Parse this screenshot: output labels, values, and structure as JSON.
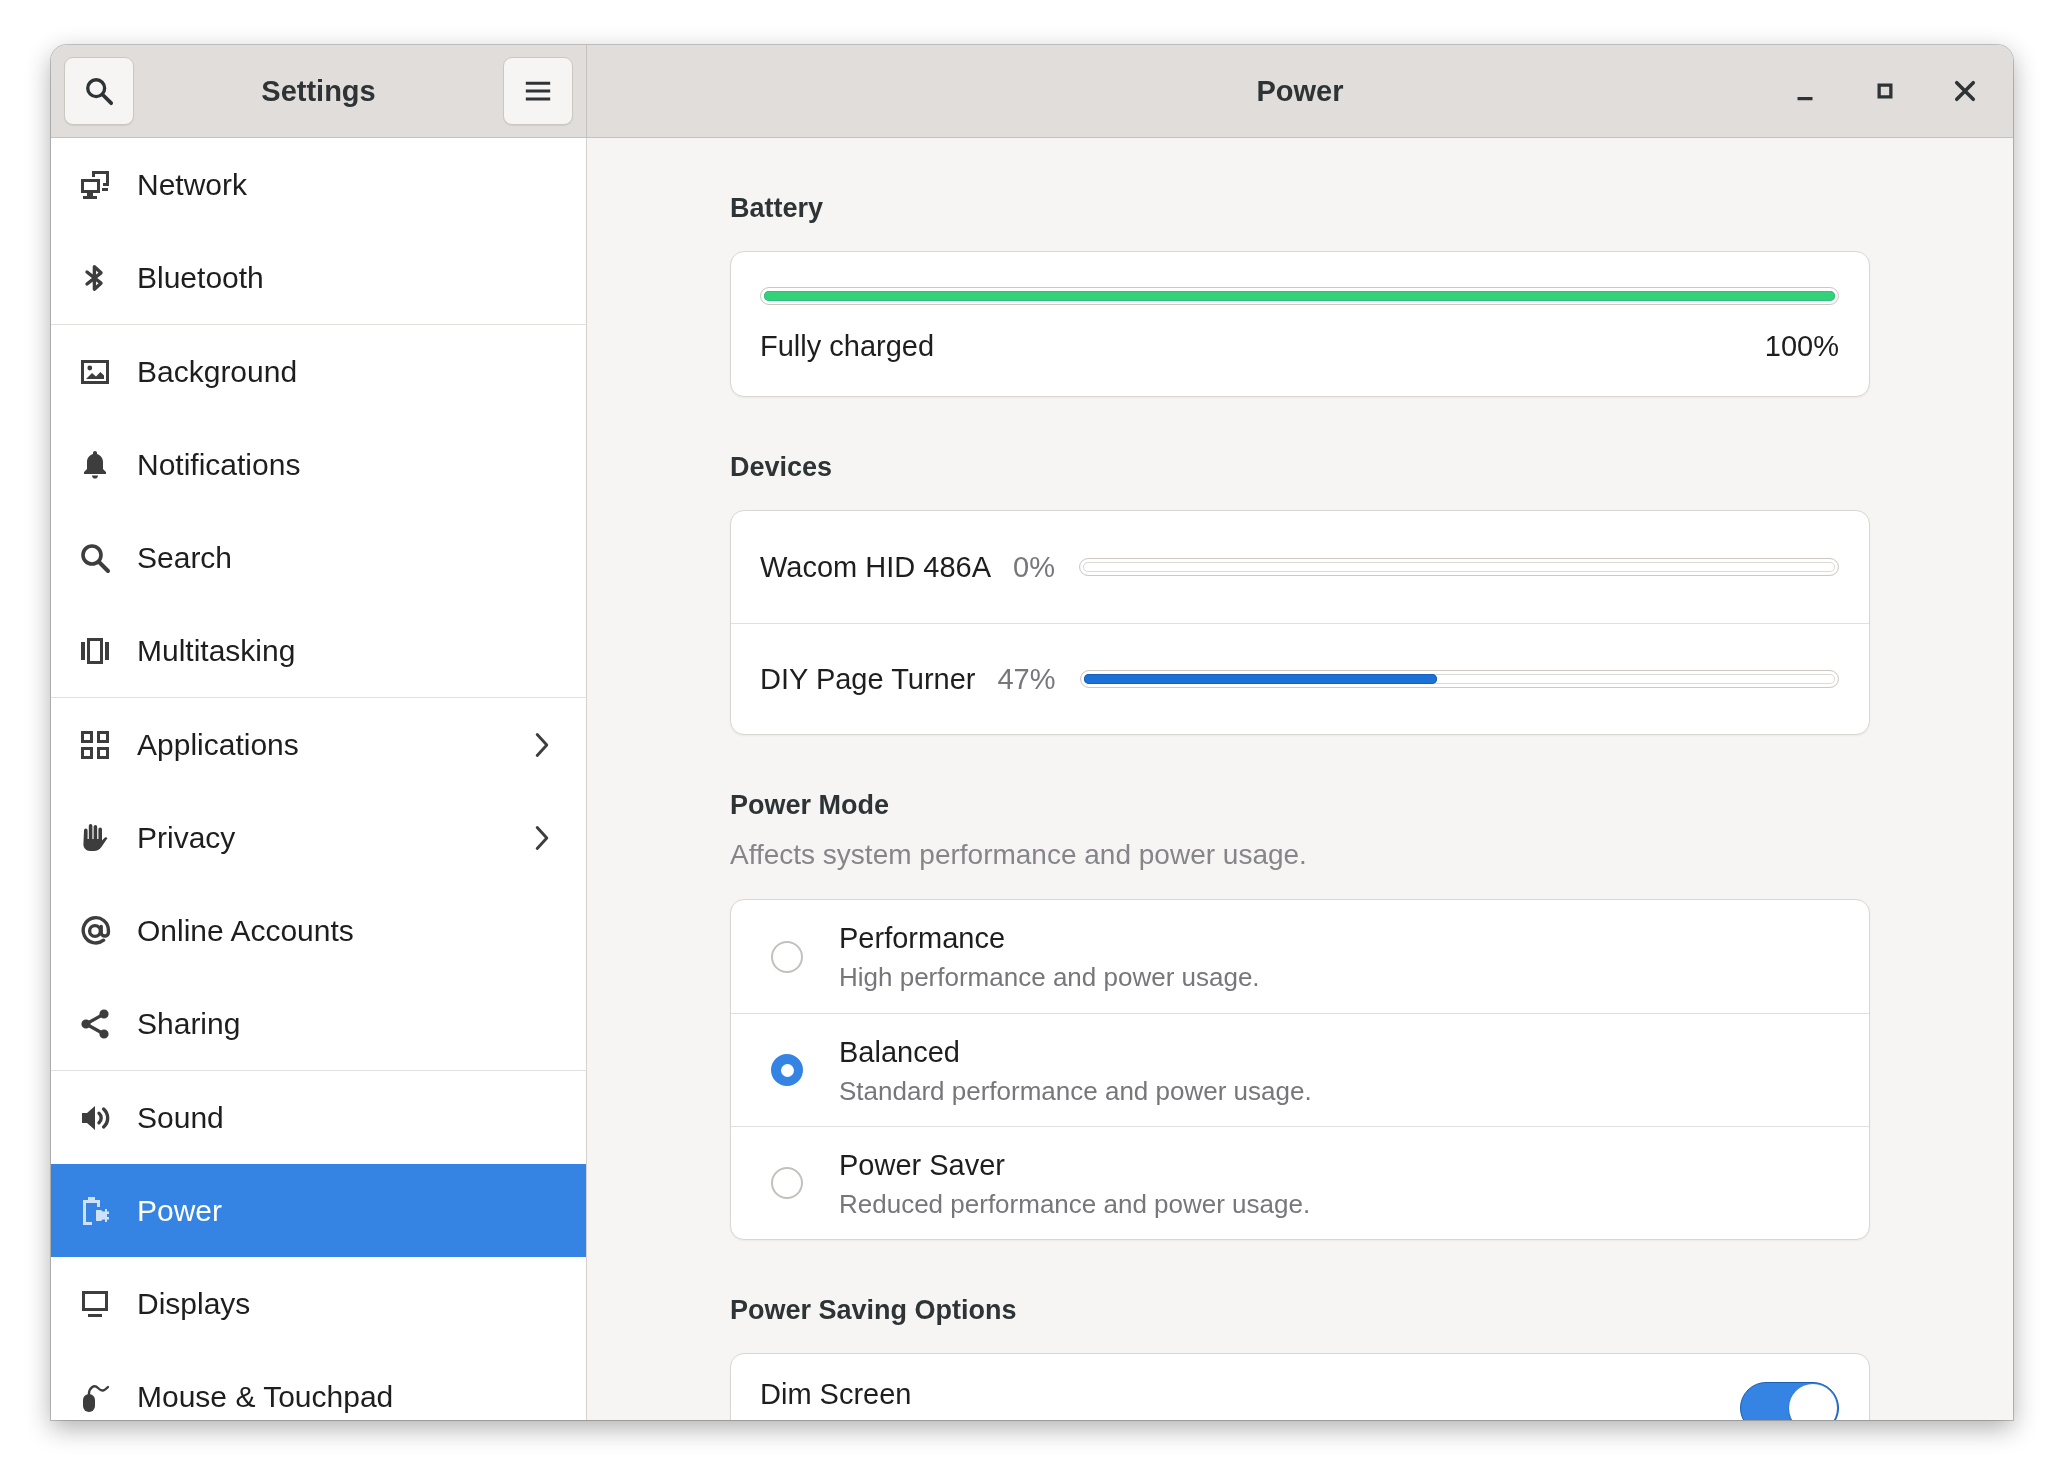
{
  "sidebar": {
    "title": "Settings",
    "groups": [
      {
        "items": [
          {
            "label": "Network",
            "selected": false,
            "has_submenu": false
          },
          {
            "label": "Bluetooth",
            "selected": false,
            "has_submenu": false
          }
        ]
      },
      {
        "items": [
          {
            "label": "Background",
            "selected": false,
            "has_submenu": false
          },
          {
            "label": "Notifications",
            "selected": false,
            "has_submenu": false
          },
          {
            "label": "Search",
            "selected": false,
            "has_submenu": false
          },
          {
            "label": "Multitasking",
            "selected": false,
            "has_submenu": false
          }
        ]
      },
      {
        "items": [
          {
            "label": "Applications",
            "selected": false,
            "has_submenu": true
          },
          {
            "label": "Privacy",
            "selected": false,
            "has_submenu": true
          },
          {
            "label": "Online Accounts",
            "selected": false,
            "has_submenu": false
          },
          {
            "label": "Sharing",
            "selected": false,
            "has_submenu": false
          }
        ]
      },
      {
        "items": [
          {
            "label": "Sound",
            "selected": false,
            "has_submenu": false
          },
          {
            "label": "Power",
            "selected": true,
            "has_submenu": false
          },
          {
            "label": "Displays",
            "selected": false,
            "has_submenu": false
          },
          {
            "label": "Mouse & Touchpad",
            "selected": false,
            "has_submenu": false
          }
        ]
      }
    ]
  },
  "header": {
    "title": "Power"
  },
  "battery": {
    "heading": "Battery",
    "level": 1,
    "status": "Fully charged",
    "percent": "100%"
  },
  "devices": {
    "heading": "Devices",
    "items": [
      {
        "name": "Wacom HID 486A",
        "percent": "0%"
      },
      {
        "name": "DIY Page Turner",
        "percent": "47%",
        "level": 0.47
      }
    ]
  },
  "power_mode": {
    "heading": "Power Mode",
    "description": "Affects system performance and power usage.",
    "options": [
      {
        "label": "Performance",
        "description": "High performance and power usage.",
        "selected": false
      },
      {
        "label": "Balanced",
        "description": "Standard performance and power usage.",
        "selected": true
      },
      {
        "label": "Power Saver",
        "description": "Reduced performance and power usage.",
        "selected": false
      }
    ]
  },
  "power_saving": {
    "heading": "Power Saving Options",
    "rows": [
      {
        "label": "Dim Screen",
        "on": true
      }
    ]
  }
}
